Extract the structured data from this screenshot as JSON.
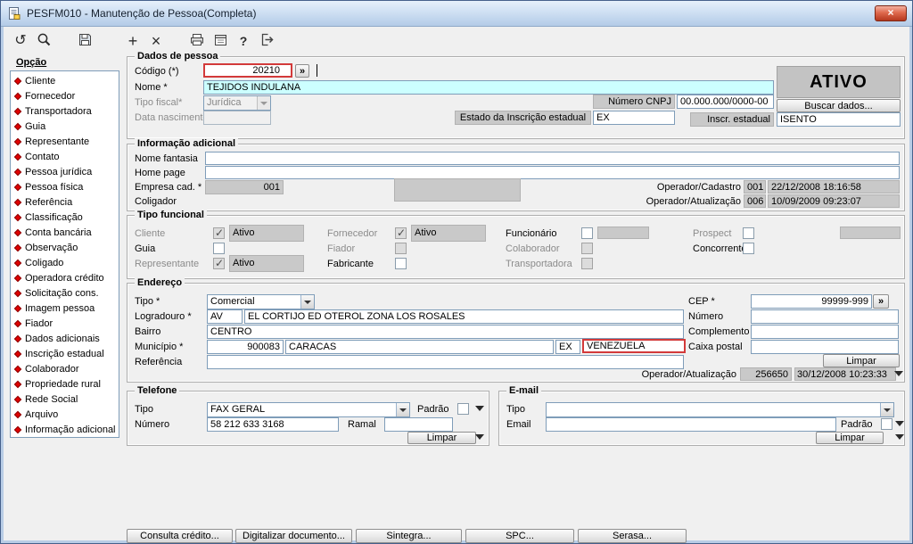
{
  "window": {
    "title": "PESFM010 - Manutenção de Pessoa(Completa)",
    "close_glyph": "×"
  },
  "toolbar": {
    "icons": [
      "undo",
      "search",
      "save",
      "add",
      "delete",
      "print",
      "calendar",
      "help",
      "exit"
    ],
    "undo_glyph": "↺",
    "add_glyph": "+",
    "delete_glyph": "×",
    "help_glyph": "?"
  },
  "sidebar": {
    "title": "Opção",
    "items": [
      "Cliente",
      "Fornecedor",
      "Transportadora",
      "Guia",
      "Representante",
      "Contato",
      "Pessoa jurídica",
      "Pessoa física",
      "Referência",
      "Classificação",
      "Conta bancária",
      "Observação",
      "Coligado",
      "Operadora crédito",
      "Solicitação cons.",
      "Imagem pessoa",
      "Fiador",
      "Dados adicionais",
      "Inscrição estadual",
      "Colaborador",
      "Propriedade rural",
      "Rede Social",
      "Arquivo",
      "Informação adicional"
    ]
  },
  "dados_pessoa": {
    "legend": "Dados de pessoa",
    "codigo_label": "Código (*)",
    "codigo_value": "20210",
    "lookup_button": "»",
    "nome_label": "Nome *",
    "nome_value": "TEJIDOS INDULANA",
    "tipo_fiscal_label": "Tipo fiscal*",
    "tipo_fiscal_value": "Jurídica",
    "data_nascimento_label": "Data nascimento",
    "status_value": "ATIVO",
    "buscar_dados_button": "Buscar dados...",
    "cnpj_label": "Número CNPJ",
    "cnpj_value": "00.000.000/0000-00",
    "estado_ie_label": "Estado da Inscrição estadual",
    "estado_ie_value": "EX",
    "inscr_estadual_label": "Inscr. estadual",
    "inscr_estadual_value": "ISENTO"
  },
  "info_adicional": {
    "legend": "Informação adicional",
    "nome_fantasia_label": "Nome fantasia",
    "home_page_label": "Home page",
    "empresa_cad_label": "Empresa cad. *",
    "empresa_cad_value": "001",
    "coligador_label": "Coligador",
    "operador_cadastro_label": "Operador/Cadastro",
    "operador_cadastro_num": "001",
    "operador_cadastro_data": "22/12/2008 18:16:58",
    "operador_atualizacao_label": "Operador/Atualização",
    "operador_atualizacao_num": "006",
    "operador_atualizacao_data": "10/09/2009 09:23:07"
  },
  "tipo_funcional": {
    "legend": "Tipo funcional",
    "cliente": "Cliente",
    "guia": "Guia",
    "representante": "Representante",
    "fornecedor": "Fornecedor",
    "fiador": "Fiador",
    "fabricante": "Fabricante",
    "funcionario": "Funcionário",
    "colaborador": "Colaborador",
    "transportadora": "Transportadora",
    "prospect": "Prospect",
    "concorrente": "Concorrente",
    "cliente_status": "Ativo",
    "fornecedor_status": "Ativo",
    "representante_status": "Ativo"
  },
  "endereco": {
    "legend": "Endereço",
    "tipo_label": "Tipo *",
    "tipo_value": "Comercial",
    "logradouro_label": "Logradouro *",
    "logradouro_tipo": "AV",
    "logradouro_value": "EL CORTIJO ED OTEROL ZONA LOS ROSALES",
    "bairro_label": "Bairro",
    "bairro_value": "CENTRO",
    "municipio_label": "Município *",
    "municipio_codigo": "900083",
    "municipio_nome": "CARACAS",
    "municipio_uf": "EX",
    "municipio_pais": "VENEZUELA",
    "referencia_label": "Referência",
    "cep_label": "CEP *",
    "cep_value": "99999-999",
    "cep_lookup": "»",
    "numero_label": "Número",
    "complemento_label": "Complemento",
    "caixa_postal_label": "Caixa postal",
    "limpar_button": "Limpar",
    "operador_atualizacao_label": "Operador/Atualização",
    "operador_atualizacao_num": "256650",
    "operador_atualizacao_data": "30/12/2008 10:23:33"
  },
  "telefone": {
    "legend": "Telefone",
    "tipo_label": "Tipo",
    "tipo_value": "FAX GERAL",
    "padrao_label": "Padrão",
    "numero_label": "Número",
    "numero_value": "58 212 633 3168",
    "ramal_label": "Ramal",
    "limpar_button": "Limpar"
  },
  "email": {
    "legend": "E-mail",
    "tipo_label": "Tipo",
    "tipo_value": "",
    "email_label": "Email",
    "padrao_label": "Padrão",
    "limpar_button": "Limpar"
  },
  "bottom_buttons": [
    "Consulta crédito...",
    "Digitalizar documento...",
    "Sintegra...",
    "SPC...",
    "Serasa..."
  ],
  "colors": {
    "title_bar": "#cfe0f3",
    "close_button_red": "#b5371e",
    "highlight_border": "#d33a3a",
    "name_field_bg": "#ccffff",
    "status_box_bg": "#c3c3c3",
    "bullet_red": "#e00000"
  }
}
